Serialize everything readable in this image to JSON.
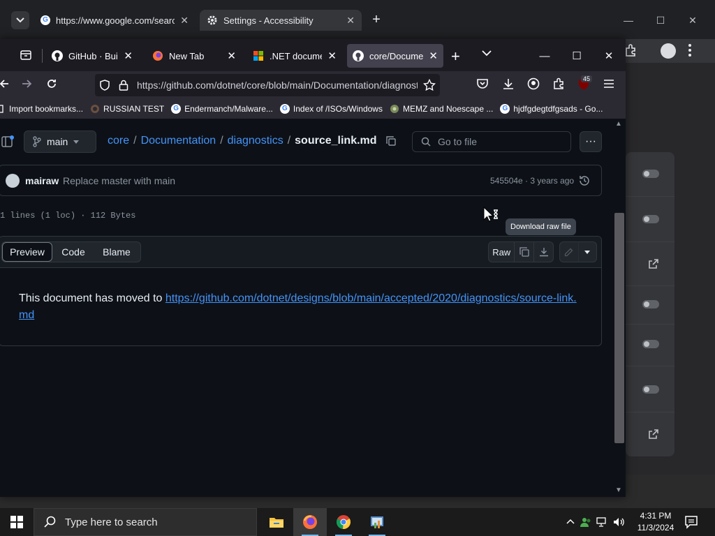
{
  "chrome": {
    "tabs": [
      {
        "label": "https://www.google.com/search"
      },
      {
        "label": "Settings - Accessibility"
      }
    ],
    "new_tab": "+",
    "window_controls": {
      "minimize": "—",
      "maximize": "☐",
      "close": "✕"
    }
  },
  "firefox": {
    "tabs": [
      {
        "label": "GitHub · Build and ship",
        "icon": "github-icon"
      },
      {
        "label": "New Tab",
        "icon": "firefox-icon"
      },
      {
        "label": ".NET documentation",
        "icon": "microsoft-icon"
      },
      {
        "label": "core/Documentation",
        "icon": "github-icon",
        "active": true
      }
    ],
    "new_tab": "+",
    "window_controls": {
      "minimize": "—",
      "maximize": "☐",
      "close": "✕"
    },
    "url": "https://github.com/dotnet/core/blob/main/Documentation/diagnostics/source_link.md",
    "extensions_badge": "45",
    "bookmarks": [
      {
        "label": "Import bookmarks...",
        "icon": "import-icon"
      },
      {
        "label": "RUSSIAN TEST",
        "icon": "globe-icon"
      },
      {
        "label": "Endermanch/Malware...",
        "icon": "google-icon"
      },
      {
        "label": "Index of /ISOs/Windows",
        "icon": "google-icon"
      },
      {
        "label": "MEMZ and Noescape ...",
        "icon": "globe-icon"
      },
      {
        "label": "hjdfgdegtdfgsads - Go...",
        "icon": "google-icon"
      }
    ]
  },
  "github": {
    "branch": "main",
    "breadcrumb": {
      "repo": "core",
      "sep": "/",
      "dir1": "Documentation",
      "dir2": "diagnostics",
      "file": "source_link.md"
    },
    "goto_file_placeholder": "Go to file",
    "more": "···",
    "commit": {
      "author": "mairaw",
      "message": "Replace master with main",
      "meta": "545504e · 3 years ago"
    },
    "file_stats": "1 lines (1 loc) · 112 Bytes",
    "view_tabs": {
      "preview": "Preview",
      "code": "Code",
      "blame": "Blame"
    },
    "raw": "Raw",
    "tooltip": "Download raw file",
    "readme": {
      "text": "This document has moved to ",
      "link": "https://github.com/dotnet/designs/blob/main/accepted/2020/diagnostics/source-link.md"
    }
  },
  "taskbar": {
    "search_placeholder": "Type here to search",
    "time": "4:31 PM",
    "date": "11/3/2024"
  },
  "colors": {
    "gh_bg": "#0d1117",
    "gh_link": "#4493f8",
    "gh_border": "#30363d",
    "firefox_chrome": "#2b2a33",
    "taskbar": "#1b1b1b"
  }
}
